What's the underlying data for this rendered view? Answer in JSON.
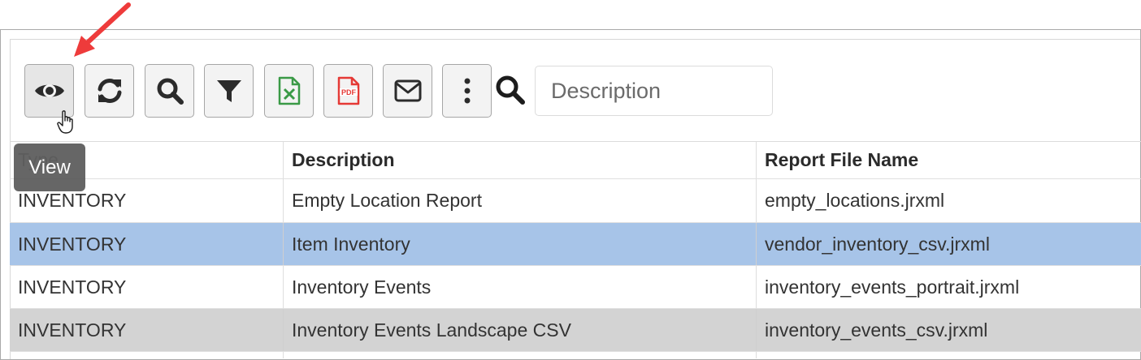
{
  "toolbar": {
    "buttons": [
      {
        "name": "view",
        "icon": "eye-icon"
      },
      {
        "name": "refresh",
        "icon": "refresh-icon"
      },
      {
        "name": "search",
        "icon": "search-icon"
      },
      {
        "name": "filter",
        "icon": "filter-icon"
      },
      {
        "name": "export-excel",
        "icon": "excel-file-icon",
        "color": "#3a9a46"
      },
      {
        "name": "export-pdf",
        "icon": "pdf-file-icon",
        "color": "#e53935"
      },
      {
        "name": "email",
        "icon": "envelope-icon"
      },
      {
        "name": "more",
        "icon": "more-vertical-icon"
      }
    ],
    "search_placeholder": "Description",
    "tooltip": "View"
  },
  "table": {
    "columns": [
      "Type",
      "Description",
      "Report File Name"
    ],
    "rows": [
      {
        "type": "INVENTORY",
        "description": "Empty Location Report",
        "file": "empty_locations.jrxml"
      },
      {
        "type": "INVENTORY",
        "description": "Item Inventory",
        "file": "vendor_inventory_csv.jrxml",
        "selected": true
      },
      {
        "type": "INVENTORY",
        "description": "Inventory Events",
        "file": "inventory_events_portrait.jrxml"
      },
      {
        "type": "INVENTORY",
        "description": "Inventory Events Landscape CSV",
        "file": "inventory_events_csv.jrxml"
      }
    ]
  },
  "colors": {
    "selected_row": "#a7c4e8",
    "alt_row": "#d3d3d3",
    "annotation_arrow": "#ee3b3b"
  }
}
